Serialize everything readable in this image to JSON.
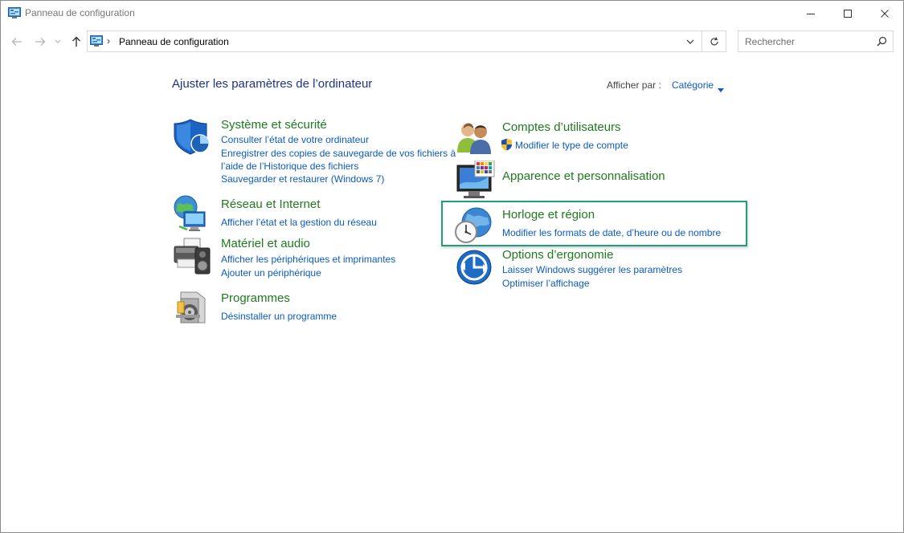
{
  "window": {
    "title": "Panneau de configuration"
  },
  "address": {
    "path": "Panneau de configuration",
    "separator": "›"
  },
  "search": {
    "placeholder": "Rechercher"
  },
  "header": {
    "title": "Ajuster les paramètres de l’ordinateur",
    "view_by_label": "Afficher par :",
    "view_by_value": "Catégorie"
  },
  "categories": {
    "system": {
      "title": "Système et sécurité",
      "icon": "shield-icon",
      "links": [
        "Consulter l’état de votre ordinateur",
        "Enregistrer des copies de sauvegarde de vos fichiers à",
        "l’aide de l’Historique des fichiers",
        "Sauvegarder et restaurer (Windows 7)"
      ]
    },
    "network": {
      "title": "Réseau et Internet",
      "icon": "network-globe-icon",
      "links": [
        "Afficher l’état et la gestion du réseau"
      ]
    },
    "hardware": {
      "title": "Matériel et audio",
      "icon": "printer-speaker-icon",
      "links": [
        "Afficher les périphériques et imprimantes",
        "Ajouter un périphérique"
      ]
    },
    "programs": {
      "title": "Programmes",
      "icon": "programs-disc-icon",
      "links": [
        "Désinstaller un programme"
      ]
    },
    "users": {
      "title": "Comptes d’utilisateurs",
      "icon": "users-icon",
      "links": [
        "Modifier le type de compte"
      ]
    },
    "appearance": {
      "title": "Apparence et personnalisation",
      "icon": "monitor-palette-icon",
      "links": []
    },
    "clock": {
      "title": "Horloge et région",
      "icon": "clock-globe-icon",
      "links": [
        "Modifier les formats de date, d’heure ou de nombre"
      ]
    },
    "ease": {
      "title": "Options d’ergonomie",
      "icon": "ease-of-access-icon",
      "links": [
        "Laisser Windows suggérer les paramètres",
        "Optimiser l’affichage"
      ]
    }
  },
  "colors": {
    "category_title": "#1e7a1e",
    "link": "#0a5bc4",
    "page_title": "#1e3287",
    "highlight_border": "#1f9e7a"
  }
}
